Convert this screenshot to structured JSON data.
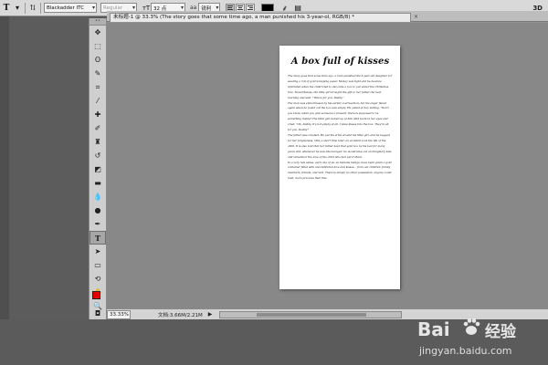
{
  "options_bar": {
    "font_family": "Blackadder ITC",
    "font_style": "Regular",
    "font_size": "32 点",
    "antialias_label": "aa",
    "antialias_mode": "锐利",
    "text_color": "#000000",
    "mode_3d": "3D"
  },
  "document": {
    "tab_title": "未标题-1 @ 33.3% (The story goes that some time ago, a man punished his 3-year-ol, RGB/8) *",
    "tab_close": "×"
  },
  "paper": {
    "title": "A box full of kisses",
    "paragraphs": [
      "The story goes that some time ago, a man punished his 3-year-old daughter for wasting a roll of gold wrapping paper. Money was tight and he became infuriated when the child tried to decorate a box to put under the Christmas tree. Nevertheless, the little girl brought the gift to her father the next morning and said, \"This is for you, Daddy.\"",
      "The man was embarrassed by his earlier overreaction, but his anger flared again when he found out the box was empty. He yelled at her, stating, \"Don't you know, when you give someone a present, there is supposed to be something inside? The little girl looked up at him with tears in her eyes and cried, \"Oh, Daddy, it's not empty at all. I blew kisses into the box. They're all for you, Daddy.\"",
      "The father was crushed. He put his arms around his little girl, and he begged for her forgiveness. Only a short time later, an accident took the life of the child. It is also told that her father kept that gold box by his bed for many years and, whenever he was discouraged, he would take out an imaginary kiss and remember the love of the child who had put it there.",
      "In a very real sense, each one of us, as humans beings, have been given a gold container filled with unconditional love and kisses... from our children, family members, friends, and God. There is simply no other possession, anyone could hold, more precious than this."
    ]
  },
  "status_bar": {
    "zoom": "33.33%",
    "doc_info": "文档:3.66M/2.21M",
    "arrow": "▶"
  },
  "watermark": {
    "brand": "Bai",
    "brand_suffix": "经验",
    "url": "jingyan.baidu.com"
  },
  "colors": {
    "foreground": "#e00000",
    "background": "#ffffff"
  }
}
